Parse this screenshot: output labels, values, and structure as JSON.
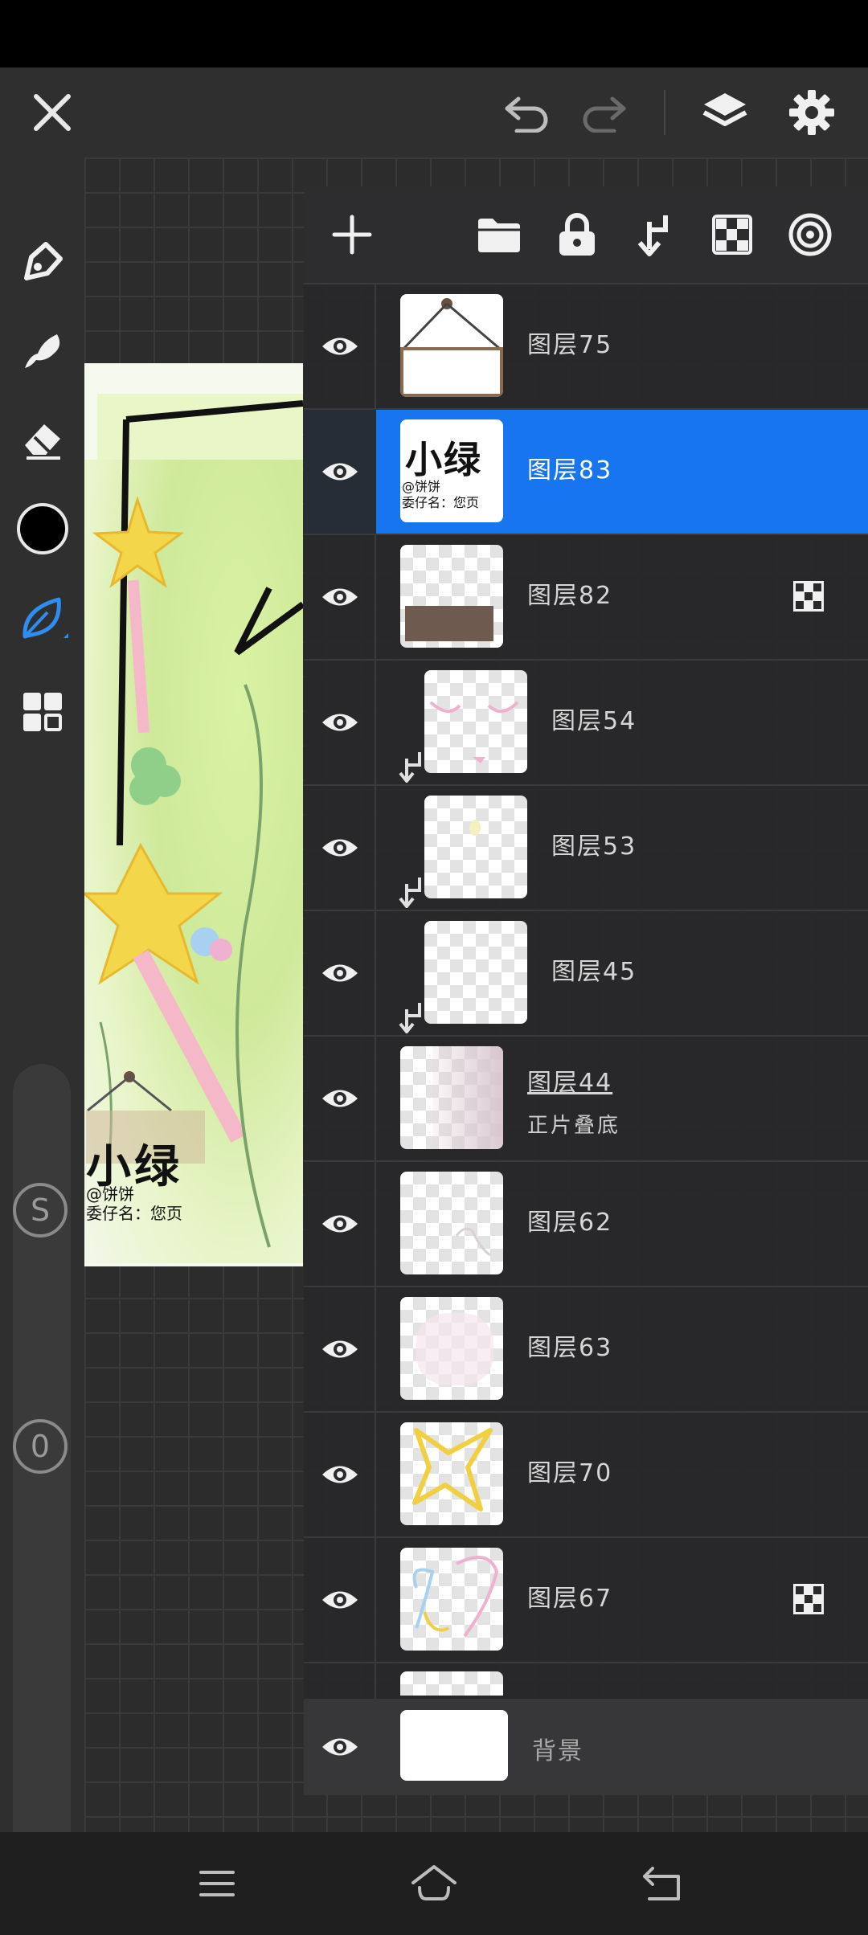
{
  "app": {
    "accent_color": "#1875f0",
    "background_color": "#2a2a2b"
  },
  "topbar": {
    "close_icon": "close-icon",
    "undo_icon": "undo-icon",
    "redo_icon": "redo-icon",
    "layers_icon": "layers-icon",
    "settings_icon": "gear-icon"
  },
  "left_toolbar": {
    "tools": [
      "pen-icon",
      "smudge-icon",
      "eraser-icon",
      "color-swatch",
      "leaf-brush-icon",
      "grid-menu-icon"
    ],
    "color": "#000000",
    "brush_size_badge": "S",
    "opacity_badge": "0"
  },
  "artwork": {
    "sign_text": "小绿",
    "sign_sub_line1": "@饼饼",
    "sign_sub_line2": "委仔名：您页"
  },
  "layers_panel": {
    "header_icons": [
      "add-icon",
      "folder-icon",
      "lock-icon",
      "merge-down-icon",
      "alpha-icon",
      "reference-icon"
    ],
    "layers": [
      {
        "name": "图层75",
        "selected": false,
        "clipped": false,
        "alpha_locked": false,
        "blend": ""
      },
      {
        "name": "图层83",
        "selected": true,
        "clipped": false,
        "alpha_locked": false,
        "blend": ""
      },
      {
        "name": "图层82",
        "selected": false,
        "clipped": false,
        "alpha_locked": true,
        "blend": ""
      },
      {
        "name": "图层54",
        "selected": false,
        "clipped": true,
        "alpha_locked": false,
        "blend": ""
      },
      {
        "name": "图层53",
        "selected": false,
        "clipped": true,
        "alpha_locked": false,
        "blend": ""
      },
      {
        "name": "图层45",
        "selected": false,
        "clipped": true,
        "alpha_locked": false,
        "blend": ""
      },
      {
        "name": "图层44",
        "selected": false,
        "clipped": false,
        "alpha_locked": false,
        "blend": "正片叠底"
      },
      {
        "name": "图层62",
        "selected": false,
        "clipped": false,
        "alpha_locked": false,
        "blend": ""
      },
      {
        "name": "图层63",
        "selected": false,
        "clipped": false,
        "alpha_locked": false,
        "blend": ""
      },
      {
        "name": "图层70",
        "selected": false,
        "clipped": false,
        "alpha_locked": false,
        "blend": ""
      },
      {
        "name": "图层67",
        "selected": false,
        "clipped": false,
        "alpha_locked": true,
        "blend": ""
      }
    ],
    "background_layer": {
      "name": "背景"
    },
    "thumb83_text": "小绿",
    "thumb83_sub1": "@饼饼",
    "thumb83_sub2": "委仔名：您页"
  },
  "navbar": {
    "icons": [
      "menu-icon",
      "home-icon",
      "back-icon"
    ]
  }
}
